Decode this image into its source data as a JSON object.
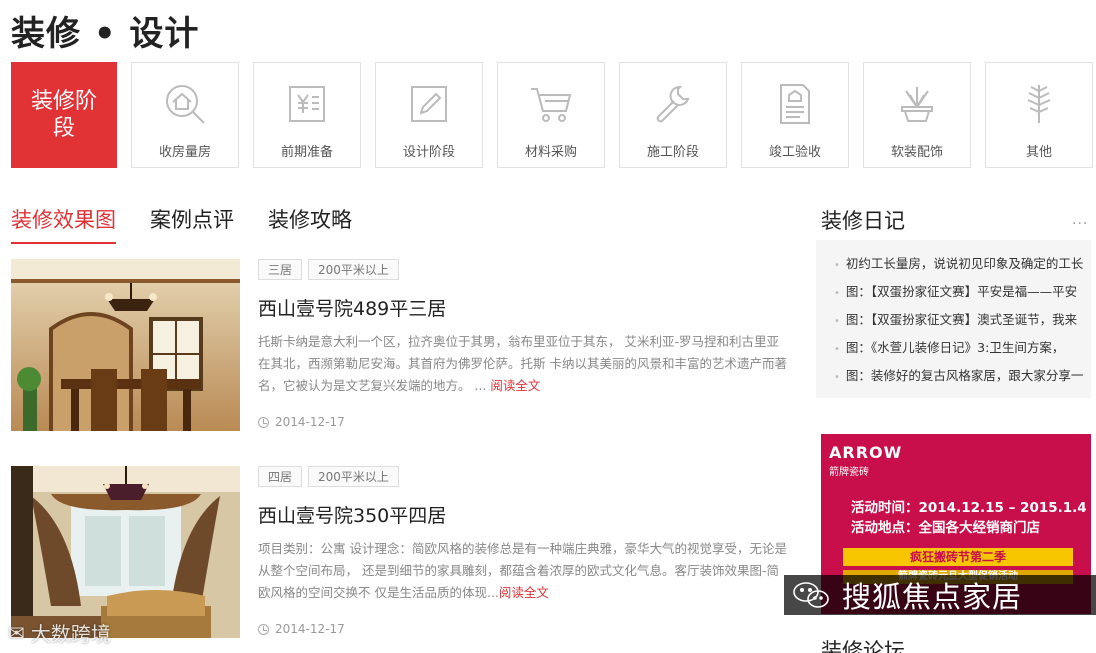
{
  "page_title": "装修 • 设计",
  "stages": {
    "main_label": "装修阶段",
    "items": [
      {
        "label": "收房量房",
        "icon": "house-search-icon"
      },
      {
        "label": "前期准备",
        "icon": "yen-document-icon"
      },
      {
        "label": "设计阶段",
        "icon": "pencil-icon"
      },
      {
        "label": "材料采购",
        "icon": "shopping-cart-icon"
      },
      {
        "label": "施工阶段",
        "icon": "wrench-icon"
      },
      {
        "label": "竣工验收",
        "icon": "checklist-icon"
      },
      {
        "label": "软装配饰",
        "icon": "plant-pot-icon"
      },
      {
        "label": "其他",
        "icon": "leaf-icon"
      }
    ]
  },
  "tabs": [
    {
      "label": "装修效果图",
      "active": true
    },
    {
      "label": "案例点评",
      "active": false
    },
    {
      "label": "装修攻略",
      "active": false
    }
  ],
  "articles": [
    {
      "tags": [
        "三居",
        "200平米以上"
      ],
      "title": "西山壹号院489平三居",
      "desc": "托斯卡纳是意大利一个区，拉齐奥位于其男，翁布里亚位于其东， 艾米利亚-罗马捏和利古里亚在其北，西濒第勒尼安海。其首府为佛罗伦萨。托斯 卡纳以其美丽的风景和丰富的艺术遗产而著名，它被认为是文艺复兴发端的地方。 ...",
      "read_more": "阅读全文",
      "date": "2014-12-17"
    },
    {
      "tags": [
        "四居",
        "200平米以上"
      ],
      "title": "西山壹号院350平四居",
      "desc": "项目类别：公寓 设计理念：简欧风格的装修总是有一种端庄典雅，豪华大气的视觉享受，无论是从整个空间布局， 还是到细节的家具雕刻，都蕴含着浓厚的欧式文化气息。客厅装饰效果图-简欧风格的空间交换不 仅是生活品质的体现...",
      "read_more": "阅读全文",
      "date": "2014-12-17"
    }
  ],
  "diary": {
    "title": "装修日记",
    "more": "...",
    "items": [
      "初约工长量房，说说初见印象及确定的工长",
      "图：【双蛋扮家征文赛】平安是福——平安",
      "图：【双蛋扮家征文赛】澳式圣诞节，我来",
      "图：《水萱儿装修日记》3:卫生间方案，",
      "图：装修好的复古风格家居，跟大家分享一"
    ]
  },
  "ad": {
    "brand": "ARROW",
    "brand_sub": "箭牌瓷砖",
    "line1": "活动时间：2014.12.15 – 2015.1.4",
    "line2": "活动地点：全国各大经销商门店",
    "banner": "疯狂搬砖节第二季",
    "banner2": "箭牌瓷砖元旦大型促销活动"
  },
  "watermark": {
    "right": "搜狐焦点家居",
    "left": "大数跨境"
  },
  "next_section": "装修论坛",
  "colors": {
    "accent": "#e13236",
    "ad_bg": "#c90f4b"
  }
}
